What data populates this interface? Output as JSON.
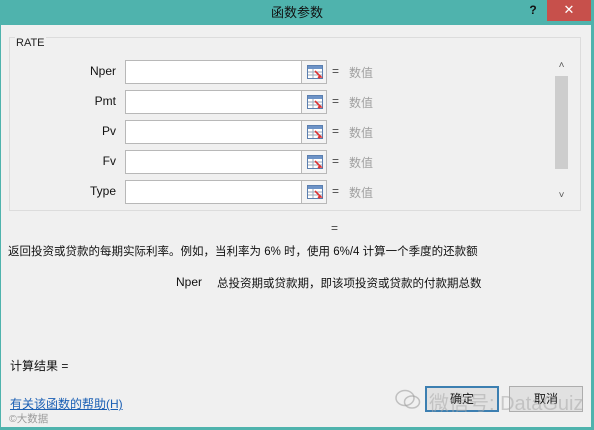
{
  "dialog": {
    "title": "函数参数",
    "help_glyph": "?",
    "close_glyph": "✕"
  },
  "group": {
    "function_name": "RATE",
    "fields": [
      {
        "label": "Nper",
        "value": "",
        "equals": "=",
        "result": "数值"
      },
      {
        "label": "Pmt",
        "value": "",
        "equals": "=",
        "result": "数值"
      },
      {
        "label": "Pv",
        "value": "",
        "equals": "=",
        "result": "数值"
      },
      {
        "label": "Fv",
        "value": "",
        "equals": "=",
        "result": "数值"
      },
      {
        "label": "Type",
        "value": "",
        "equals": "=",
        "result": "数值"
      }
    ],
    "scroll_up": "˄",
    "scroll_down": "˅"
  },
  "formula_equals": "=",
  "description": "返回投资或贷款的每期实际利率。例如，当利率为 6% 时，使用 6%/4 计算一个季度的还款额",
  "argument_help": {
    "name": "Nper",
    "text": "总投资期或贷款期，即该项投资或贷款的付款期总数"
  },
  "calc_result": "计算结果 =",
  "help_link": "有关该函数的帮助(H)",
  "buttons": {
    "ok": "确定",
    "cancel": "取消"
  },
  "watermark": {
    "badge": "©大数据",
    "text": "微信号: DataGuiz"
  },
  "colors": {
    "title_bar": "#4fb3ad",
    "close_button": "#c7504b",
    "link": "#1a5fb4",
    "placeholder": "#a0a0a0"
  }
}
